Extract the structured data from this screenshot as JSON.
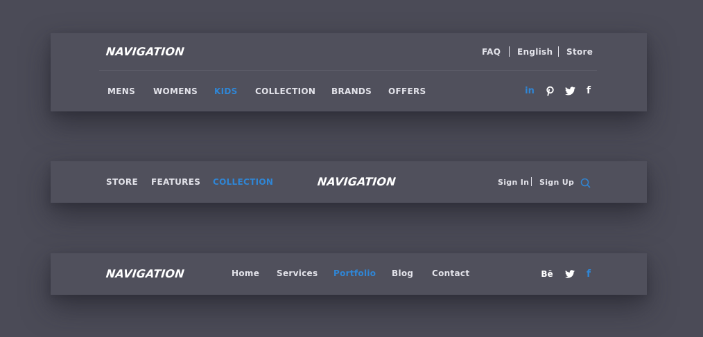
{
  "bar1": {
    "logo": "NAVIGATION",
    "top_links": [
      "FAQ",
      "English",
      "Store"
    ],
    "menu": [
      "MENS",
      "WOMENS",
      "KIDS",
      "COLLECTION",
      "BRANDS",
      "OFFERS"
    ],
    "active_menu": "KIDS",
    "social": [
      "linkedin-icon",
      "pinterest-icon",
      "twitter-icon",
      "facebook-icon"
    ],
    "social_text": {
      "linkedin": "in",
      "facebook": "f"
    }
  },
  "bar2": {
    "menu": [
      "STORE",
      "FEATURES",
      "COLLECTION"
    ],
    "active_menu": "COLLECTION",
    "logo": "NAVIGATION",
    "sign_in": "Sign In",
    "sign_up": "Sign Up",
    "icons": [
      "search-icon"
    ]
  },
  "bar3": {
    "logo": "NAVIGATION",
    "menu": [
      "Home",
      "Services",
      "Portfolio",
      "Blog",
      "Contact"
    ],
    "active_menu": "Portfolio",
    "social": [
      "behance-icon",
      "twitter-icon",
      "facebook-icon"
    ],
    "social_text": {
      "behance": "Bē",
      "facebook": "f"
    }
  },
  "colors": {
    "background": "#4b4b57",
    "bar": "#50505c",
    "accent": "#2f86d6",
    "text": "#e3e3ea"
  }
}
